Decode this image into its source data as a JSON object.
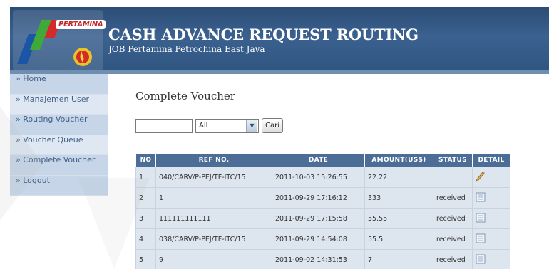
{
  "header": {
    "logo_text": "PERTAMINA",
    "title": "CASH ADVANCE REQUEST ROUTING",
    "subtitle": "JOB Pertamina Petrochina East Java"
  },
  "sidebar": {
    "items": [
      {
        "label": "» Home"
      },
      {
        "label": "» Manajemen User"
      },
      {
        "label": "» Routing Voucher"
      },
      {
        "label": "» Voucher Queue"
      },
      {
        "label": "» Complete Voucher"
      },
      {
        "label": "» Logout"
      }
    ]
  },
  "main": {
    "page_title": "Complete Voucher",
    "search": {
      "input_value": "",
      "select_value": "All",
      "button_label": "Cari"
    },
    "table": {
      "headers": [
        "NO",
        "REF NO.",
        "DATE",
        "AMOUNT(US$)",
        "STATUS",
        "DETAIL"
      ],
      "rows": [
        {
          "no": "1",
          "ref": "040/CARV/P-PEJ/TF-ITC/15",
          "date": "2011-10-03 15:26:55",
          "amount": "22.22",
          "status": "",
          "detail_icon": "pencil-icon"
        },
        {
          "no": "2",
          "ref": "1",
          "date": "2011-09-29 17:16:12",
          "amount": "333",
          "status": "received",
          "detail_icon": "document-icon"
        },
        {
          "no": "3",
          "ref": "111111111111",
          "date": "2011-09-29 17:15:58",
          "amount": "55.55",
          "status": "received",
          "detail_icon": "document-icon"
        },
        {
          "no": "4",
          "ref": "038/CARV/P-PEJ/TF-ITC/15",
          "date": "2011-09-29 14:54:08",
          "amount": "55.5",
          "status": "received",
          "detail_icon": "document-icon"
        },
        {
          "no": "5",
          "ref": "9",
          "date": "2011-09-02 14:31:53",
          "amount": "7",
          "status": "received",
          "detail_icon": "document-icon"
        }
      ]
    }
  },
  "colors": {
    "header_bg": "#3b6190",
    "table_header_bg": "#4b6d96",
    "sidebar_link": "#41618a",
    "logo_red": "#c0282a"
  }
}
